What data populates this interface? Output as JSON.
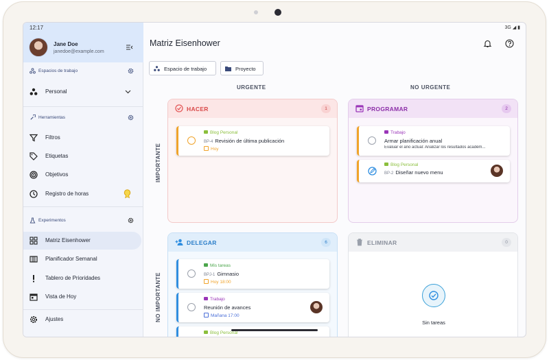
{
  "status": {
    "time": "12:17",
    "network": "3G"
  },
  "user": {
    "name": "Jane Doe",
    "email": "janedoe@example.com"
  },
  "sidebar": {
    "workspaces": {
      "title": "Espacios de trabajo",
      "item": "Personal"
    },
    "tools": {
      "title": "Herramientas",
      "items": [
        "Filtros",
        "Etiquetas",
        "Objetivos",
        "Registro de horas"
      ]
    },
    "experiments": {
      "title": "Experimentos",
      "items": [
        "Matriz Eisenhower",
        "Planificador Semanal",
        "Tablero de Prioridades",
        "Vista de Hoy"
      ]
    },
    "settings": "Ajustes"
  },
  "header": {
    "title": "Matriz Eisenhower"
  },
  "chips": {
    "workspace": "Espacio de trabajo",
    "project": "Proyecto"
  },
  "axes": {
    "col1": "URGENTE",
    "col2": "NO URGENTE",
    "row1": "IMPORTANTE",
    "row2": "NO IMPORTANTE"
  },
  "quadrants": {
    "do": {
      "title": "HACER",
      "count": "1",
      "tasks": [
        {
          "project": "Blog Personal",
          "code": "BP-4",
          "title": "Revisión de última publicación",
          "due": "Hoy"
        }
      ]
    },
    "schedule": {
      "title": "PROGRAMAR",
      "count": "2",
      "tasks": [
        {
          "project": "Trabajo",
          "title": "Armar planificación anual",
          "desc": "Evaluar el año actual: Analizar los resultados académ..."
        },
        {
          "project": "Blog Personal",
          "code": "BP-2",
          "title": "Diseñar nuevo menu"
        }
      ]
    },
    "delegate": {
      "title": "DELEGAR",
      "count": "6",
      "tasks": [
        {
          "project": "Mis tareas",
          "code": "BPJ-1",
          "title": "Gimnasio",
          "due": "Hoy 18:00"
        },
        {
          "project": "Trabajo",
          "title": "Reunión de avances",
          "due": "Mañana 17:00"
        },
        {
          "project": "Blog Personal"
        }
      ]
    },
    "eliminate": {
      "title": "ELIMINAR",
      "count": "0",
      "empty": "Sin tareas"
    }
  },
  "colors": {
    "do": "#e45a5a",
    "schedule": "#9a35b8",
    "delegate": "#2f8ee0",
    "eliminate": "#9aa0ab",
    "accent": "#f0a32a"
  }
}
